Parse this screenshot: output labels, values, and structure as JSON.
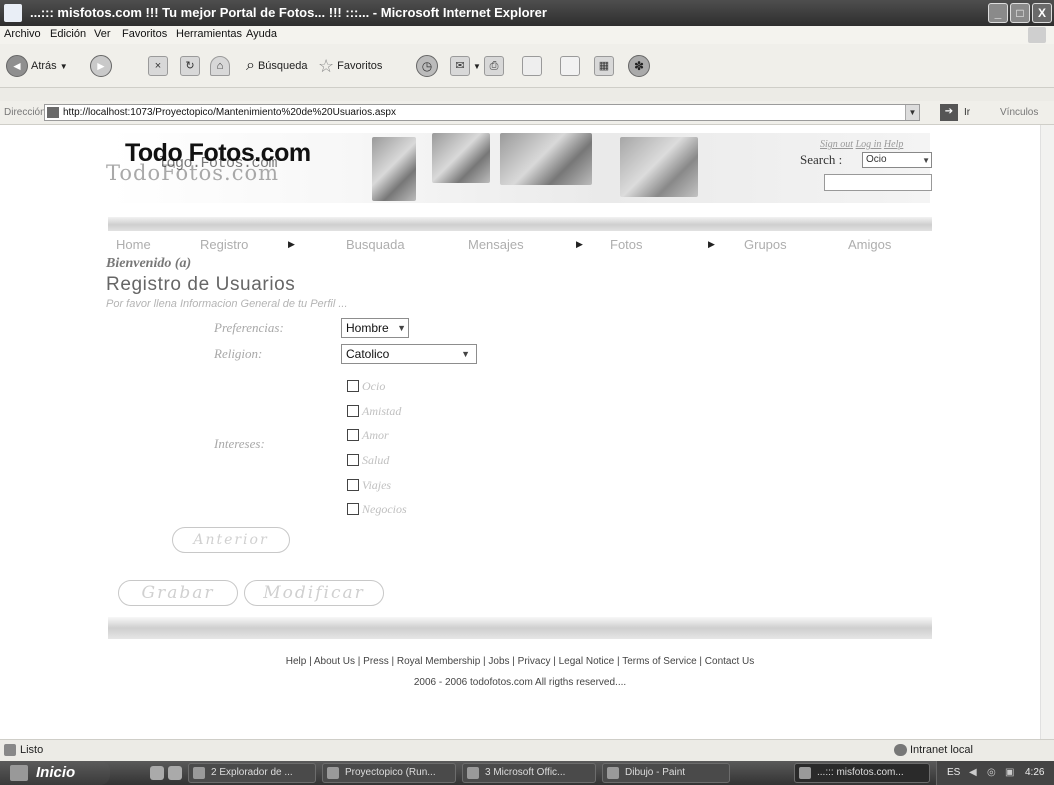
{
  "window": {
    "title": "...::: misfotos.com !!! Tu mejor Portal de Fotos... !!! :::... - Microsoft Internet Explorer",
    "min": "_",
    "max": "□",
    "close": "X"
  },
  "menu": [
    "Archivo",
    "Edición",
    "Ver",
    "Favoritos",
    "Herramientas",
    "Ayuda"
  ],
  "toolbar": {
    "back": "Atrás",
    "search": "Búsqueda",
    "favorites": "Favoritos"
  },
  "address": {
    "label": "Dirección",
    "url": "http://localhost:1073/Proyectopico/Mantenimiento%20de%20Usuarios.aspx",
    "go": "Ir",
    "links": "Vínculos"
  },
  "site": {
    "logo": "Todo Fotos.com",
    "logo_ghost": "TodoFotos.com",
    "logo_ghost2": "logo.Fotos.com",
    "signlinks": [
      "Sign out",
      "Log in",
      "Help"
    ],
    "search_label": "Search :",
    "search_option": "Ocio"
  },
  "nav": {
    "items": [
      "Home",
      "Registro",
      "Busquada",
      "Mensajes",
      "Fotos",
      "Grupos",
      "Amigos"
    ]
  },
  "page": {
    "welcome": "Bienvenido (a)",
    "title": "Registro de Usuarios",
    "subtitle": "Por favor llena Informacion General de tu Perfil ..."
  },
  "form": {
    "pref_label": "Preferencias:",
    "pref_value": "Hombre",
    "religion_label": "Religion:",
    "religion_value": "Catolico",
    "interests_label": "Intereses:",
    "interests": [
      "Ocio",
      "Amistad",
      "Amor",
      "Salud",
      "Viajes",
      "Negocios"
    ],
    "btn_prev": "Anterior",
    "btn_save": "Grabar",
    "btn_modify": "Modificar"
  },
  "footer": {
    "links": "Help | About Us | Press | Royal Membership | Jobs | Privacy | Legal Notice | Terms of Service | Contact Us",
    "copyright": "2006 - 2006 todofotos.com All rigths reserved...."
  },
  "status": {
    "left": "Listo",
    "right": "Intranet local"
  },
  "taskbar": {
    "start": "Inicio",
    "tasks": [
      "2 Explorador de ...",
      "Proyectopico (Run...",
      "3 Microsoft Offic...",
      "Dibujo - Paint",
      "...::: misfotos.com..."
    ],
    "tray": "ES",
    "clock": "4:26"
  }
}
